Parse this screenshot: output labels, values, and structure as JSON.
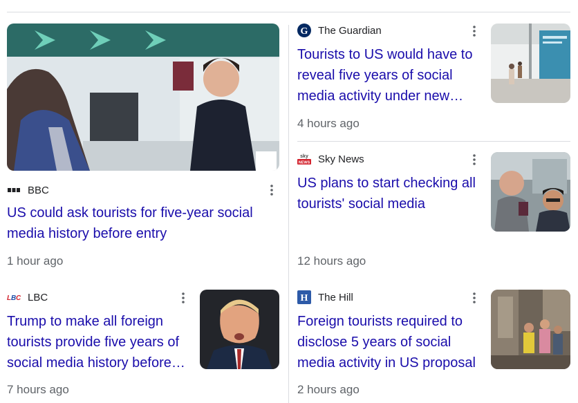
{
  "stories": [
    {
      "source": "BBC",
      "title": "US could ask tourists for five-year social media history before entry",
      "time": "1 hour ago"
    },
    {
      "source": "The Guardian",
      "title": "Tourists to US would have to reveal five years of social media activity under new…",
      "time": "4 hours ago"
    },
    {
      "source": "Sky News",
      "title": "US plans to start checking all tourists' social media",
      "time": "12 hours ago"
    },
    {
      "source": "LBC",
      "title": "Trump to make all foreign tourists provide five years of social media history before…",
      "time": "7 hours ago"
    },
    {
      "source": "The Hill",
      "title": "Foreign tourists required to disclose 5 years of social media activity in US proposal",
      "time": "2 hours ago"
    }
  ],
  "favicons": {
    "bbc": "bbc-icon",
    "guardian": "guardian-icon",
    "skynews": "sky-news-icon",
    "lbc": "lbc-icon",
    "thehill": "the-hill-icon"
  },
  "colors": {
    "link": "#1a0dab",
    "meta": "#5f6368",
    "divider": "#dadce0"
  }
}
